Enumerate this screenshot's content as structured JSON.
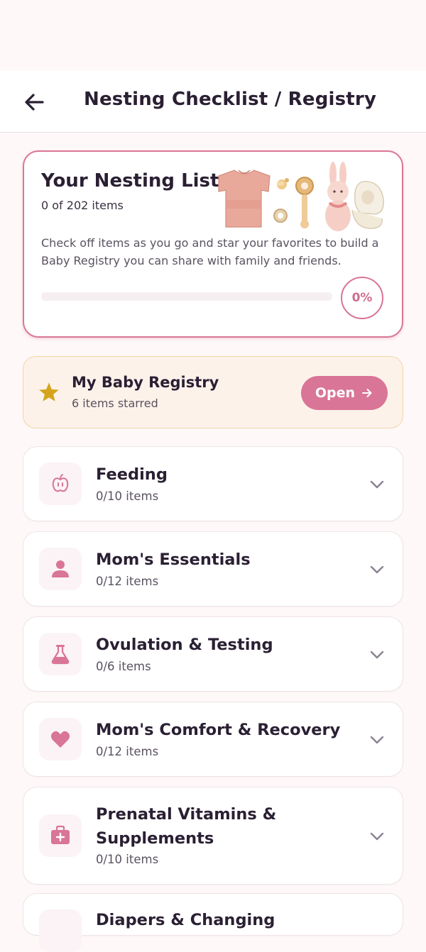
{
  "header": {
    "title": "Nesting Checklist / Registry"
  },
  "summary": {
    "title": "Your Nesting List",
    "count_text": "0 of 202 items",
    "description": "Check off items as you go and star your favorites to build a Baby Registry you can share with family and friends.",
    "progress_percent": 0,
    "progress_label": "0%"
  },
  "registry": {
    "title": "My Baby Registry",
    "subtitle": "6 items starred",
    "open_label": "Open"
  },
  "categories": [
    {
      "title": "Feeding",
      "count": "0/10 items",
      "icon": "apple-icon"
    },
    {
      "title": "Mom's Essentials",
      "count": "0/12 items",
      "icon": "person-icon"
    },
    {
      "title": "Ovulation & Testing",
      "count": "0/6 items",
      "icon": "flask-icon"
    },
    {
      "title": "Mom's Comfort & Recovery",
      "count": "0/12 items",
      "icon": "heart-icon"
    },
    {
      "title_line1": "Prenatal Vitamins &",
      "title_line2": "Supplements",
      "count": "0/10 items",
      "icon": "medical-kit-icon"
    },
    {
      "title": "Diapers & Changing",
      "icon": "diaper-icon"
    }
  ],
  "colors": {
    "accent": "#d97596",
    "star": "#d4a51c",
    "background": "#fff8f9"
  }
}
